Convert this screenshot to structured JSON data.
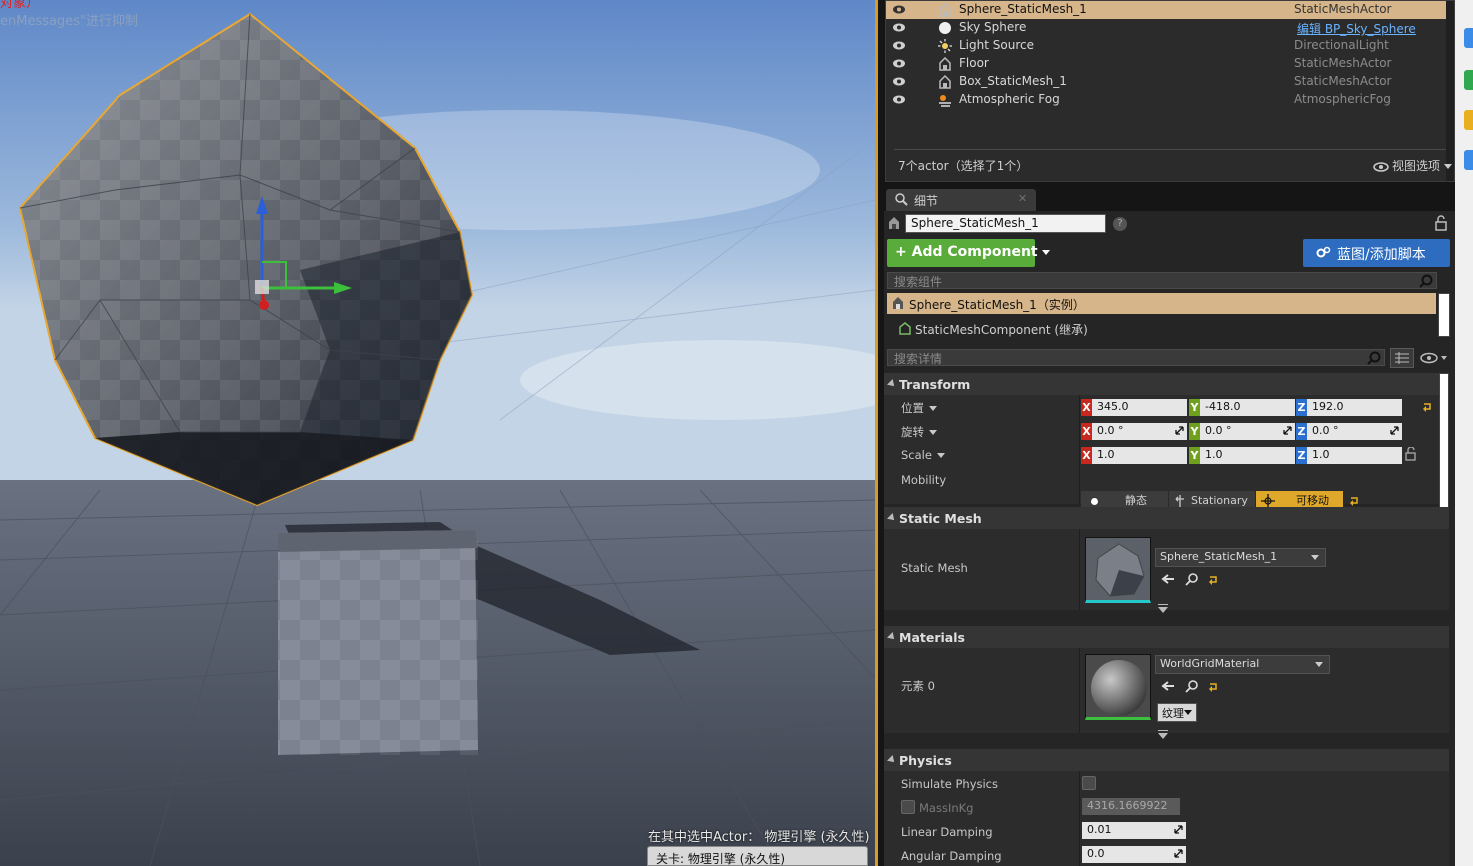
{
  "viewport": {
    "top_red_text": "对象）",
    "top_message": "enMessages\"进行抑制",
    "status_text": "在其中选中Actor：  物理引擎 (永久性)",
    "level_text": "关卡: 物理引擎 (永久性)"
  },
  "outliner": {
    "rows": [
      {
        "name": "Sphere_StaticMesh_1",
        "type": "StaticMeshActor",
        "icon": "static-mesh-actor-icon",
        "selected": true
      },
      {
        "name": "Sky Sphere",
        "type": "编辑 BP_Sky_Sphere",
        "icon": "sky-sphere-icon",
        "link": true
      },
      {
        "name": "Light Source",
        "type": "DirectionalLight",
        "icon": "directional-light-icon"
      },
      {
        "name": "Floor",
        "type": "StaticMeshActor",
        "icon": "static-mesh-actor-icon"
      },
      {
        "name": "Box_StaticMesh_1",
        "type": "StaticMeshActor",
        "icon": "static-mesh-actor-icon"
      },
      {
        "name": "Atmospheric Fog",
        "type": "AtmosphericFog",
        "icon": "atmospheric-fog-icon"
      }
    ],
    "count_text": "7个actor（选择了1个）",
    "view_options": "视图选项"
  },
  "details": {
    "tab_label": "细节",
    "actor_name": "Sphere_StaticMesh_1",
    "add_component_label": "+ Add Component",
    "blueprint_label": "蓝图/添加脚本",
    "search_components_placeholder": "搜索组件",
    "component_root": "Sphere_StaticMesh_1（实例）",
    "component_child": "StaticMeshComponent (继承)",
    "search_details_placeholder": "搜索详情"
  },
  "transform": {
    "title": "Transform",
    "location_label": "位置",
    "rotation_label": "旋转",
    "scale_label": "Scale",
    "mobility_label": "Mobility",
    "location": {
      "x": "345.0",
      "y": "-418.0",
      "z": "192.0"
    },
    "rotation": {
      "x": "0.0 °",
      "y": "0.0 °",
      "z": "0.0 °"
    },
    "scale": {
      "x": "1.0",
      "y": "1.0",
      "z": "1.0"
    },
    "mobility_options": [
      "静态",
      "Stationary",
      "可移动"
    ],
    "mobility_selected": "可移动"
  },
  "static_mesh": {
    "title": "Static Mesh",
    "label": "Static Mesh",
    "value": "Sphere_StaticMesh_1"
  },
  "materials": {
    "title": "Materials",
    "element_label": "元素 0",
    "value": "WorldGridMaterial",
    "texture_button": "纹理"
  },
  "physics": {
    "title": "Physics",
    "simulate_label": "Simulate Physics",
    "simulate_checked": false,
    "mass_label": "MassInKg",
    "mass_value": "4316.1669922",
    "linear_label": "Linear Damping",
    "linear_value": "0.01",
    "angular_label": "Angular Damping",
    "angular_value": "0.0"
  },
  "colors": {
    "selection": "#d6b58a",
    "add_component": "#5aac3a",
    "blueprint": "#2d6cbf",
    "mobility_active": "#e0a82a",
    "viewport_outline": "#d79b2a"
  }
}
